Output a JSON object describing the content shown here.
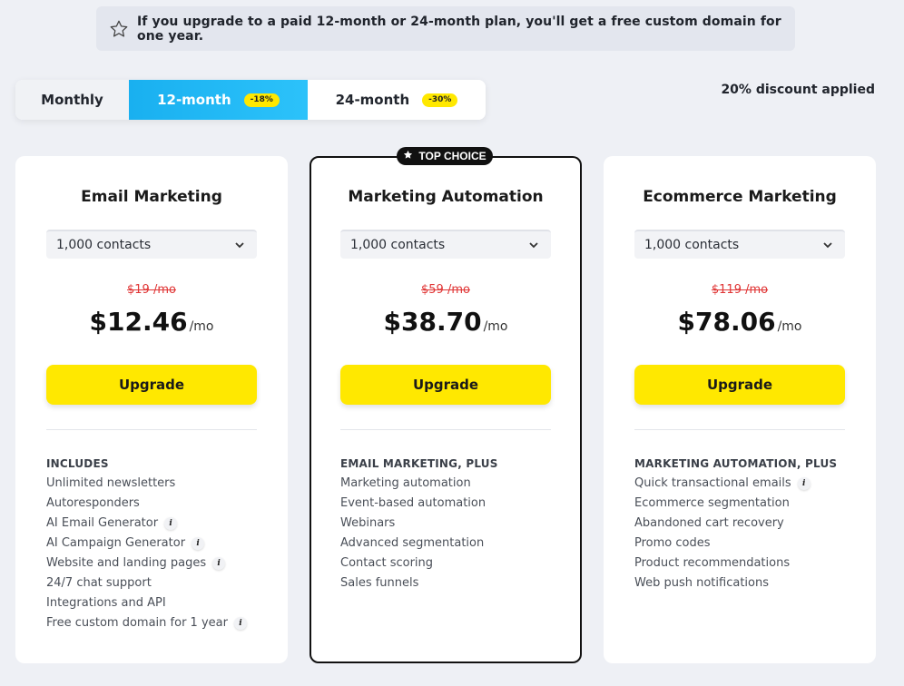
{
  "banner": {
    "icon": "star-outline-icon",
    "text": "If you upgrade to a paid 12-month or 24-month plan, you'll get a free custom domain for one year."
  },
  "billing": {
    "options": [
      {
        "label": "Monthly",
        "badge": ""
      },
      {
        "label": "12-month",
        "badge": "-18%"
      },
      {
        "label": "24-month",
        "badge": "-30%"
      }
    ],
    "selected": "12-month",
    "discount_text": "20% discount applied"
  },
  "top_choice_label": "TOP CHOICE",
  "plans": [
    {
      "title": "Email Marketing",
      "contacts": "1,000 contacts",
      "old_price": "$19 /mo",
      "price": "$12.46",
      "per": "/mo",
      "cta": "Upgrade",
      "features_heading": "INCLUDES",
      "features": [
        {
          "label": "Unlimited newsletters",
          "info": false
        },
        {
          "label": "Autoresponders",
          "info": false
        },
        {
          "label": "AI Email Generator",
          "info": true
        },
        {
          "label": "AI Campaign Generator",
          "info": true
        },
        {
          "label": "Website and landing pages",
          "info": true
        },
        {
          "label": "24/7 chat support",
          "info": false
        },
        {
          "label": "Integrations and API",
          "info": false
        },
        {
          "label": "Free custom domain for 1 year",
          "info": true
        }
      ]
    },
    {
      "title": "Marketing Automation",
      "contacts": "1,000 contacts",
      "old_price": "$59 /mo",
      "price": "$38.70",
      "per": "/mo",
      "cta": "Upgrade",
      "features_heading": "EMAIL MARKETING, PLUS",
      "features": [
        {
          "label": "Marketing automation",
          "info": false
        },
        {
          "label": "Event-based automation",
          "info": false
        },
        {
          "label": "Webinars",
          "info": false
        },
        {
          "label": "Advanced segmentation",
          "info": false
        },
        {
          "label": "Contact scoring",
          "info": false
        },
        {
          "label": "Sales funnels",
          "info": false
        }
      ]
    },
    {
      "title": "Ecommerce Marketing",
      "contacts": "1,000 contacts",
      "old_price": "$119 /mo",
      "price": "$78.06",
      "per": "/mo",
      "cta": "Upgrade",
      "features_heading": "MARKETING AUTOMATION, PLUS",
      "features": [
        {
          "label": "Quick transactional emails",
          "info": true
        },
        {
          "label": "Ecommerce segmentation",
          "info": false
        },
        {
          "label": "Abandoned cart recovery",
          "info": false
        },
        {
          "label": "Promo codes",
          "info": false
        },
        {
          "label": "Product recommendations",
          "info": false
        },
        {
          "label": "Web push notifications",
          "info": false
        }
      ]
    }
  ],
  "info_glyph": "i",
  "colors": {
    "accent_blue": "#19b0f0",
    "cta_yellow": "#ffe800",
    "old_price_red": "#e03636",
    "background": "#eef0f5"
  }
}
